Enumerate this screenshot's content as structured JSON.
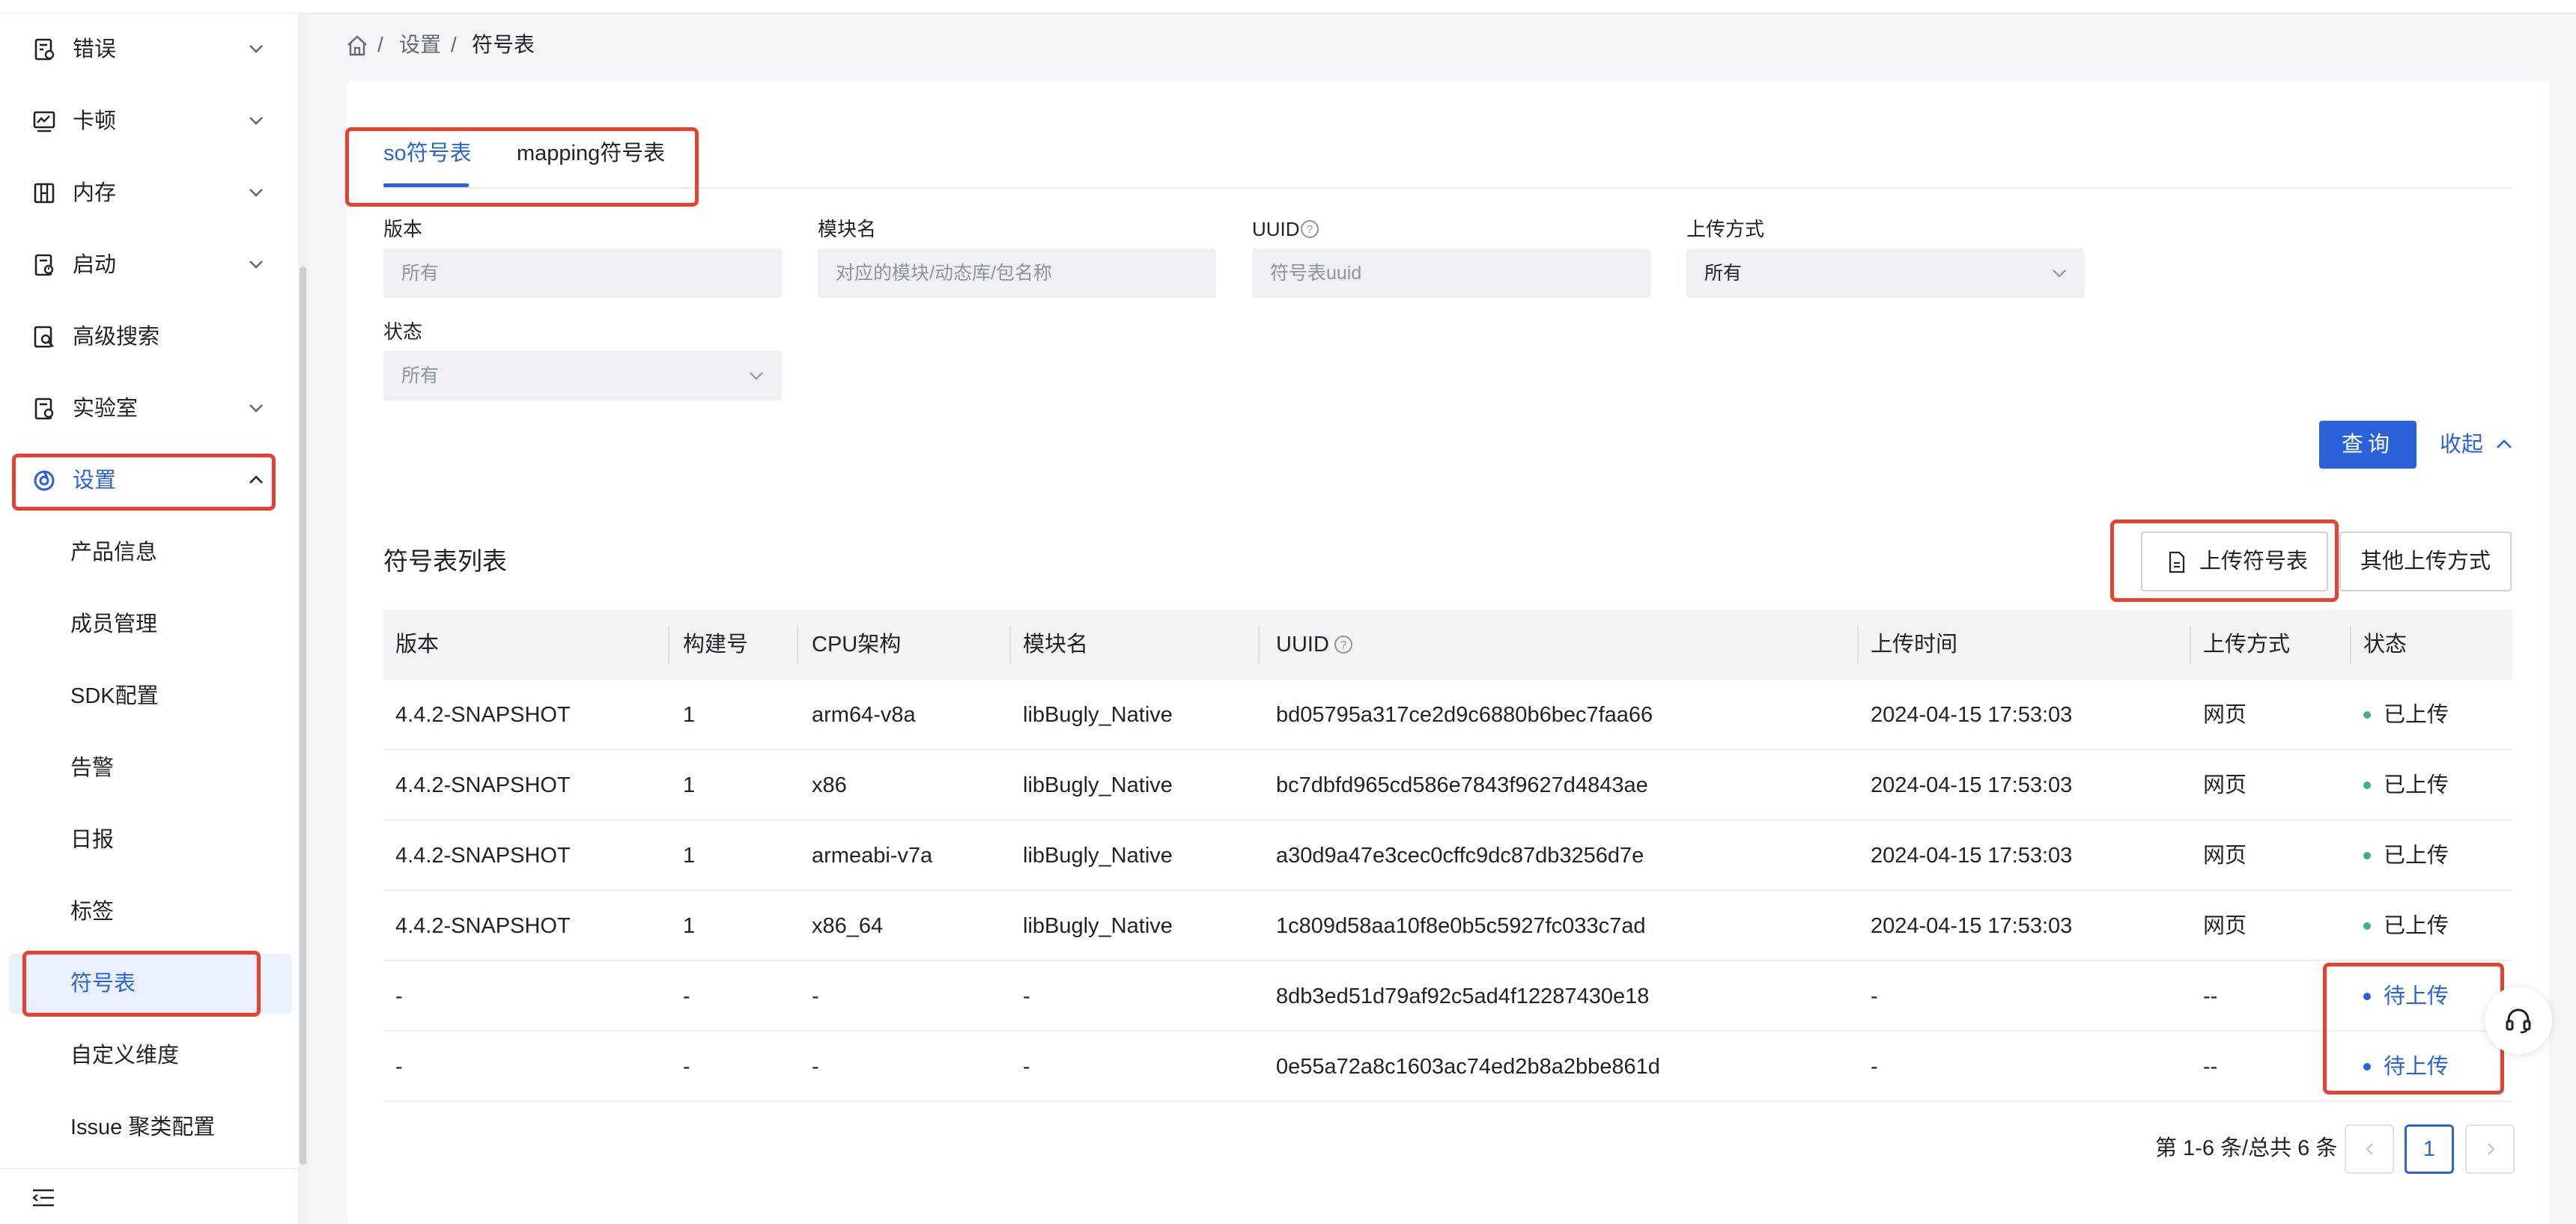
{
  "sidebar": {
    "nav": [
      {
        "label": "错误",
        "icon": "error-report-icon",
        "chevron": true
      },
      {
        "label": "卡顿",
        "icon": "lag-chart-icon",
        "chevron": true
      },
      {
        "label": "内存",
        "icon": "memory-icon",
        "chevron": true
      },
      {
        "label": "启动",
        "icon": "launch-icon",
        "chevron": true
      },
      {
        "label": "高级搜索",
        "icon": "advanced-search-icon",
        "chevron": false
      },
      {
        "label": "实验室",
        "icon": "lab-icon",
        "chevron": true
      },
      {
        "label": "设置",
        "icon": "settings-icon",
        "chevron": true,
        "expanded": true
      }
    ],
    "settings_children": [
      "产品信息",
      "成员管理",
      "SDK配置",
      "告警",
      "日报",
      "标签",
      "符号表",
      "自定义维度",
      "Issue 聚类配置"
    ],
    "active_child": "符号表"
  },
  "breadcrumb": {
    "items": [
      "设置",
      "符号表"
    ],
    "separator": "/"
  },
  "tabs": {
    "items": [
      "so符号表",
      "mapping符号表"
    ],
    "active": "so符号表"
  },
  "filters": {
    "version": {
      "label": "版本",
      "placeholder": "所有"
    },
    "module": {
      "label": "模块名",
      "placeholder": "对应的模块/动态库/包名称"
    },
    "uuid": {
      "label": "UUID",
      "placeholder": "符号表uuid"
    },
    "upload_method": {
      "label": "上传方式",
      "value": "所有"
    },
    "status": {
      "label": "状态",
      "value": "所有"
    }
  },
  "actions": {
    "query": "查询",
    "collapse": "收起"
  },
  "list": {
    "title": "符号表列表",
    "upload_button": "上传符号表",
    "other_upload_button": "其他上传方式",
    "columns": [
      "版本",
      "构建号",
      "CPU架构",
      "模块名",
      "UUID",
      "上传时间",
      "上传方式",
      "状态"
    ],
    "rows": [
      {
        "version": "4.4.2-SNAPSHOT",
        "build": "1",
        "cpu": "arm64-v8a",
        "module": "libBugly_Native",
        "uuid": "bd05795a317ce2d9c6880b6bec7faa66",
        "time": "2024-04-15 17:53:03",
        "method": "网页",
        "status": "已上传"
      },
      {
        "version": "4.4.2-SNAPSHOT",
        "build": "1",
        "cpu": "x86",
        "module": "libBugly_Native",
        "uuid": "bc7dbfd965cd586e7843f9627d4843ae",
        "time": "2024-04-15 17:53:03",
        "method": "网页",
        "status": "已上传"
      },
      {
        "version": "4.4.2-SNAPSHOT",
        "build": "1",
        "cpu": "armeabi-v7a",
        "module": "libBugly_Native",
        "uuid": "a30d9a47e3cec0cffc9dc87db3256d7e",
        "time": "2024-04-15 17:53:03",
        "method": "网页",
        "status": "已上传"
      },
      {
        "version": "4.4.2-SNAPSHOT",
        "build": "1",
        "cpu": "x86_64",
        "module": "libBugly_Native",
        "uuid": "1c809d58aa10f8e0b5c5927fc033c7ad",
        "time": "2024-04-15 17:53:03",
        "method": "网页",
        "status": "已上传"
      },
      {
        "version": "-",
        "build": "-",
        "cpu": "-",
        "module": "-",
        "uuid": "8db3ed51d79af92c5ad4f12287430e18",
        "time": "-",
        "method": "--",
        "status": "待上传"
      },
      {
        "version": "-",
        "build": "-",
        "cpu": "-",
        "module": "-",
        "uuid": "0e55a72a8c1603ac74ed2b8a2bbe861d",
        "time": "-",
        "method": "--",
        "status": "待上传"
      }
    ]
  },
  "pagination": {
    "summary": "第 1-6 条/总共 6 条",
    "current_page": "1"
  },
  "colors": {
    "accent": "#2a63d9",
    "highlight_box": "#e8412f",
    "uploaded_dot": "#3db577",
    "pending_dot": "#2a63d9"
  }
}
